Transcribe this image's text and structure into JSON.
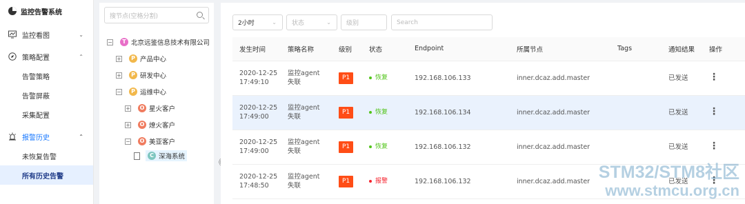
{
  "app": {
    "title": "监控告警系统"
  },
  "sidebar": {
    "groups": [
      {
        "label": "监控看图",
        "icon": "chart-icon",
        "chevron": "down"
      },
      {
        "label": "策略配置",
        "icon": "compass-icon",
        "chevron": "up",
        "items": [
          "告警策略",
          "告警屏蔽",
          "采集配置"
        ]
      },
      {
        "label": "报警历史",
        "icon": "alarm-icon",
        "chevron": "up",
        "items": [
          "未恢复告警",
          "所有历史告警"
        ]
      }
    ],
    "selected": "所有历史告警"
  },
  "tree": {
    "search_placeholder": "搜节点(空格分割)",
    "nodes": [
      {
        "label": "北京远鉴信息技术有限公司",
        "badge": "T",
        "badge_color": "#e86fc8",
        "toggle": "−"
      },
      {
        "label": "产品中心",
        "badge": "P",
        "badge_color": "#f2b84b",
        "toggle": "+"
      },
      {
        "label": "研发中心",
        "badge": "P",
        "badge_color": "#f2b84b",
        "toggle": "+"
      },
      {
        "label": "运维中心",
        "badge": "P",
        "badge_color": "#f2b84b",
        "toggle": "−"
      },
      {
        "label": "星火客户",
        "badge": "O",
        "badge_color": "#f07c5f",
        "toggle": "+"
      },
      {
        "label": "燎火客户",
        "badge": "O",
        "badge_color": "#f07c5f",
        "toggle": "+"
      },
      {
        "label": "美亚客户",
        "badge": "O",
        "badge_color": "#f07c5f",
        "toggle": "−"
      },
      {
        "label": "深海系统",
        "badge": "C",
        "badge_color": "#7ec6c0",
        "toggle": ""
      }
    ],
    "collapse_glyph": "《"
  },
  "filters": {
    "time": "2小时",
    "status_placeholder": "状态",
    "level_placeholder": "级别",
    "search_placeholder": "Search"
  },
  "table": {
    "headers": [
      "发生时间",
      "策略名称",
      "级别",
      "状态",
      "Endpoint",
      "所属节点",
      "Tags",
      "通知结果",
      "操作"
    ],
    "rows": [
      {
        "time1": "2020-12-25",
        "time2": "17:49:10",
        "name1": "监控agent",
        "name2": "失联",
        "level": "P1",
        "status": "恢复",
        "status_color": "#52c41a",
        "endpoint": "192.168.106.133",
        "node": "inner.dcaz.add.master",
        "tags": "",
        "notify": "已发送"
      },
      {
        "time1": "2020-12-25",
        "time2": "17:49:00",
        "name1": "监控agent",
        "name2": "失联",
        "level": "P1",
        "status": "恢复",
        "status_color": "#52c41a",
        "endpoint": "192.168.106.134",
        "node": "inner.dcaz.add.master",
        "tags": "",
        "notify": "已发送"
      },
      {
        "time1": "2020-12-25",
        "time2": "17:49:00",
        "name1": "监控agent",
        "name2": "失联",
        "level": "P1",
        "status": "恢复",
        "status_color": "#52c41a",
        "endpoint": "192.168.106.132",
        "node": "inner.dcaz.add.master",
        "tags": "",
        "notify": "已发送"
      },
      {
        "time1": "2020-12-25",
        "time2": "17:48:50",
        "name1": "监控agent",
        "name2": "失联",
        "level": "P1",
        "status": "报警",
        "status_color": "#f5222d",
        "endpoint": "192.168.106.132",
        "node": "inner.dcaz.add.master",
        "tags": "",
        "notify": "已发送"
      }
    ]
  },
  "watermark": {
    "line1": "STM32/STM8社区",
    "line2": "www.stmcu.org.cn"
  }
}
